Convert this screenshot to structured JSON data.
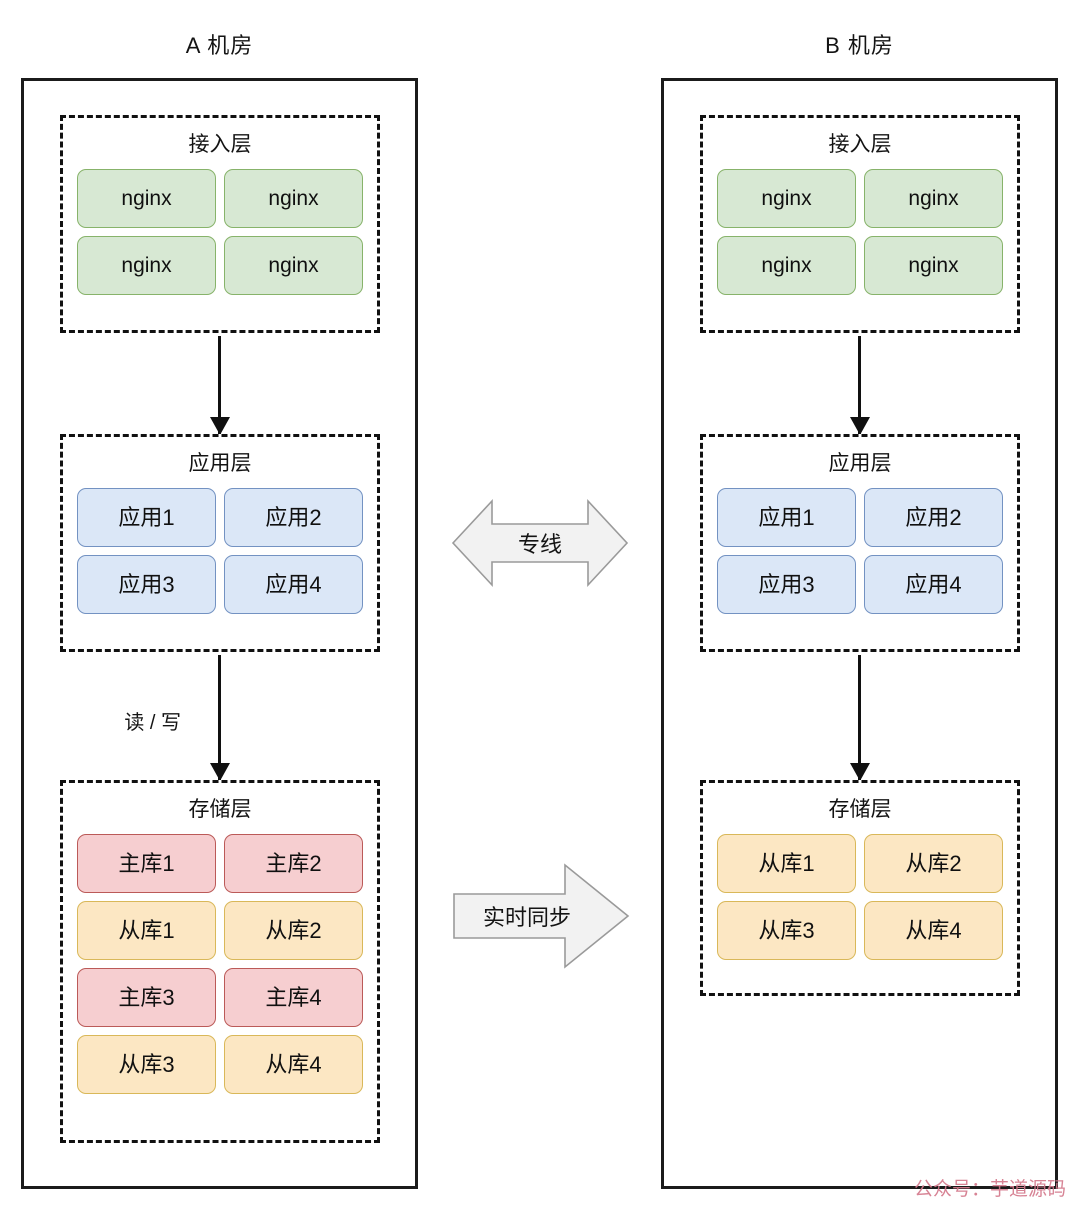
{
  "diagram": {
    "watermark": "公众号：芋道源码",
    "colors": {
      "nginx_fill": "#d7e8d3",
      "nginx_border": "#87b36a",
      "app_fill": "#dbe7f7",
      "app_border": "#7392c2",
      "master_fill": "#f6ced0",
      "master_border": "#bb5a58",
      "slave_fill": "#fce7c3",
      "slave_border": "#d9b859",
      "frame_border": "#1b1b1b",
      "watermark": "#d4798c"
    }
  },
  "datacenter_a": {
    "title": "A 机房",
    "access_layer": {
      "title": "接入层",
      "nodes": [
        "nginx",
        "nginx",
        "nginx",
        "nginx"
      ]
    },
    "app_layer": {
      "title": "应用层",
      "nodes": [
        "应用1",
        "应用2",
        "应用3",
        "应用4"
      ]
    },
    "storage_layer": {
      "title": "存储层",
      "nodes": [
        "主库1",
        "主库2",
        "从库1",
        "从库2",
        "主库3",
        "主库4",
        "从库3",
        "从库4"
      ]
    },
    "arrow_label_read_write": "读 / 写"
  },
  "datacenter_b": {
    "title": "B 机房",
    "access_layer": {
      "title": "接入层",
      "nodes": [
        "nginx",
        "nginx",
        "nginx",
        "nginx"
      ]
    },
    "app_layer": {
      "title": "应用层",
      "nodes": [
        "应用1",
        "应用2",
        "应用3",
        "应用4"
      ]
    },
    "storage_layer": {
      "title": "存储层",
      "nodes": [
        "从库1",
        "从库2",
        "从库3",
        "从库4"
      ]
    }
  },
  "links": {
    "dedicated_line": "专线",
    "realtime_sync": "实时同步"
  }
}
